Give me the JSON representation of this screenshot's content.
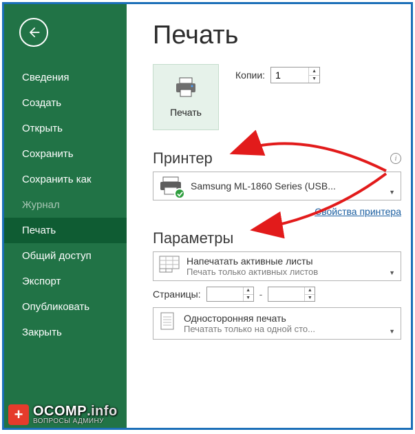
{
  "sidebar": {
    "items": [
      {
        "label": "Сведения"
      },
      {
        "label": "Создать"
      },
      {
        "label": "Открыть"
      },
      {
        "label": "Сохранить"
      },
      {
        "label": "Сохранить как"
      },
      {
        "label": "Журнал",
        "disabled": true
      },
      {
        "label": "Печать",
        "active": true
      },
      {
        "label": "Общий доступ"
      },
      {
        "label": "Экспорт"
      },
      {
        "label": "Опубликовать"
      },
      {
        "label": "Закрыть"
      }
    ]
  },
  "main": {
    "title": "Печать",
    "print_button_label": "Печать",
    "copies_label": "Копии:",
    "copies_value": "1",
    "printer_heading": "Принтер",
    "printer_selected": "Samsung ML-1860 Series (USB...",
    "printer_props_link": "Свойства принтера",
    "settings_heading": "Параметры",
    "active_sheets_dd": {
      "title": "Напечатать активные листы",
      "sub": "Печать только активных листов"
    },
    "pages_label": "Страницы:",
    "pages_from": "",
    "pages_to": "",
    "dash": "-",
    "duplex_dd": {
      "title": "Односторонняя печать",
      "sub": "Печатать только на одной сто..."
    }
  },
  "watermark": {
    "line1a": "OCOMP",
    "line1b": ".info",
    "line2": "ВОПРОСЫ АДМИНУ"
  }
}
